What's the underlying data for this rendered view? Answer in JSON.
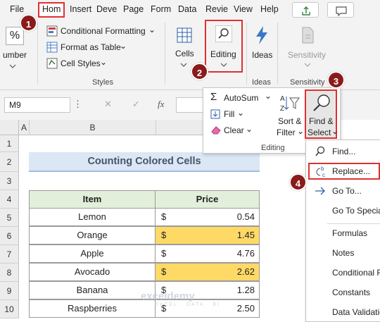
{
  "tabs": [
    {
      "label": "File"
    },
    {
      "label": "Hom"
    },
    {
      "label": "Insert"
    },
    {
      "label": "Deve"
    },
    {
      "label": "Page"
    },
    {
      "label": "Form"
    },
    {
      "label": "Data"
    },
    {
      "label": "Revie"
    },
    {
      "label": "View"
    },
    {
      "label": "Help"
    }
  ],
  "ribbon": {
    "number_label": "umber",
    "percent_icon": "%",
    "conditional_formatting": "Conditional Formatting",
    "format_as_table": "Format as Table",
    "cell_styles": "Cell Styles",
    "styles_group": "Styles",
    "cells": "Cells",
    "editing": "Editing",
    "ideas": "Ideas",
    "ideas_group": "Ideas",
    "sensitivity": "Sensitivity",
    "sensitivity_group": "Sensitivity"
  },
  "editing_dropdown": {
    "autosum": "AutoSum",
    "fill": "Fill",
    "clear": "Clear",
    "sort_filter_1": "Sort &",
    "sort_filter_2": "Filter",
    "find_select_1": "Find &",
    "find_select_2": "Select",
    "group_label": "Editing"
  },
  "formula_bar": {
    "name_box": "M9",
    "fx": "fx"
  },
  "grid": {
    "columns": [
      "A",
      "B"
    ],
    "rows": [
      "1",
      "2",
      "3",
      "4",
      "5",
      "6",
      "7",
      "8",
      "9",
      "10"
    ],
    "title": "Counting Colored Cells",
    "headers": {
      "item": "Item",
      "price": "Price"
    },
    "data": [
      {
        "item": "Lemon",
        "currency": "$",
        "price": "0.54"
      },
      {
        "item": "Orange",
        "currency": "$",
        "price": "1.45"
      },
      {
        "item": "Apple",
        "currency": "$",
        "price": "4.76"
      },
      {
        "item": "Avocado",
        "currency": "$",
        "price": "2.62"
      },
      {
        "item": "Banana",
        "currency": "$",
        "price": "1.28"
      },
      {
        "item": "Raspberries",
        "currency": "$",
        "price": "2.50"
      }
    ]
  },
  "find_menu": [
    {
      "label": "Find..."
    },
    {
      "label": "Replace..."
    },
    {
      "label": "Go To..."
    },
    {
      "label": "Go To Specia"
    },
    {
      "label": "Formulas"
    },
    {
      "label": "Notes"
    },
    {
      "label": "Conditional F"
    },
    {
      "label": "Constants"
    },
    {
      "label": "Data Validatio"
    }
  ],
  "steps": [
    "1",
    "2",
    "3",
    "4"
  ],
  "watermark": {
    "brand": "exceldemy",
    "tag": "EXCEL · DATA · BI"
  },
  "colors": {
    "highlight": "#ffd966",
    "header_fill": "#e2efda",
    "title_fill": "#dbe7f4",
    "marker": "#8b1a1a",
    "outline": "#e03030"
  }
}
